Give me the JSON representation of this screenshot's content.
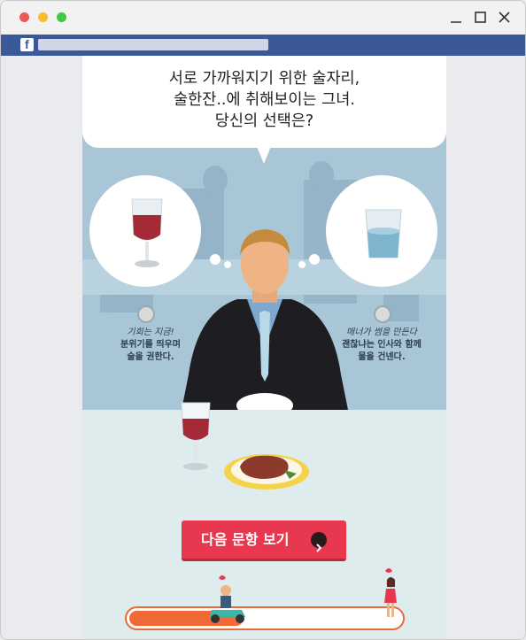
{
  "window": {
    "controls": [
      "minimize-icon",
      "maximize-icon",
      "close-icon"
    ]
  },
  "browser": {
    "logo_letter": "f"
  },
  "quiz": {
    "question_lines": [
      "서로 가까워지기 위한 술자리,",
      "술한잔..에 취해보이는 그녀.",
      "당신의 선택은?"
    ],
    "choice_left": {
      "line1": "기회는 지금!",
      "line2": "분위기를 띄우며",
      "line3": "술을 권한다.",
      "icon": "wine-glass-icon"
    },
    "choice_right": {
      "line1": "매너가 썸을 만든다",
      "line2": "괜찮냐는 인사와 함께",
      "line3": "물을 건넨다.",
      "icon": "water-glass-icon"
    },
    "next_button": "다음 문항 보기",
    "progress": 0.42
  },
  "colors": {
    "accent": "#e8384f",
    "progress": "#ef6a36",
    "facebook": "#3b5998",
    "scene_bg": "#a9c6d6"
  }
}
